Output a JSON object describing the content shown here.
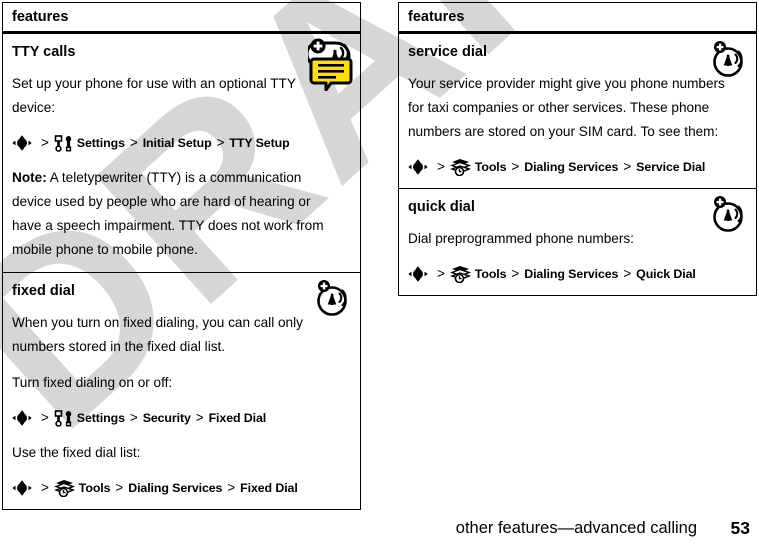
{
  "document": {
    "watermark": "DRAFT",
    "footer": {
      "title": "other features—advanced calling",
      "page_number": "53"
    }
  },
  "colors": {
    "text": "#000000",
    "rule": "#000000",
    "watermark": "#d6d6d6",
    "tty_icon_fill": "#ffe000"
  },
  "columns": [
    {
      "header": "features",
      "sections": [
        {
          "title": "TTY calls",
          "icon": "tty-icon",
          "blocks": [
            {
              "type": "para",
              "text": "Set up your phone for use with an optional TTY device:"
            },
            {
              "type": "path",
              "items": [
                {
                  "kind": "icon",
                  "name": "nav-key-icon"
                },
                {
                  "kind": "sep",
                  "text": ">"
                },
                {
                  "kind": "icon",
                  "name": "settings-icon"
                },
                {
                  "kind": "label",
                  "text": "Settings"
                },
                {
                  "kind": "sep",
                  "text": ">"
                },
                {
                  "kind": "label",
                  "text": "Initial Setup"
                },
                {
                  "kind": "sep",
                  "text": ">"
                },
                {
                  "kind": "label",
                  "text": "TTY Setup"
                }
              ]
            },
            {
              "type": "note",
              "bold": "Note:",
              "text": " A teletypewriter (TTY) is a communication device used by people who are hard of hearing or have a speech impairment. TTY does not work from mobile phone to mobile phone."
            }
          ]
        },
        {
          "title": "fixed dial",
          "icon": "network-service-icon",
          "blocks": [
            {
              "type": "para",
              "text": "When you turn on fixed dialing, you can call only numbers stored in the fixed dial list."
            },
            {
              "type": "para",
              "text": "Turn fixed dialing on or off:"
            },
            {
              "type": "path",
              "items": [
                {
                  "kind": "icon",
                  "name": "nav-key-icon"
                },
                {
                  "kind": "sep",
                  "text": ">"
                },
                {
                  "kind": "icon",
                  "name": "settings-icon"
                },
                {
                  "kind": "label",
                  "text": "Settings"
                },
                {
                  "kind": "sep",
                  "text": ">"
                },
                {
                  "kind": "label",
                  "text": "Security"
                },
                {
                  "kind": "sep",
                  "text": ">"
                },
                {
                  "kind": "label",
                  "text": "Fixed Dial"
                }
              ]
            },
            {
              "type": "para",
              "text": "Use the fixed dial list:"
            },
            {
              "type": "path",
              "items": [
                {
                  "kind": "icon",
                  "name": "nav-key-icon"
                },
                {
                  "kind": "sep",
                  "text": ">"
                },
                {
                  "kind": "icon",
                  "name": "tools-icon"
                },
                {
                  "kind": "label",
                  "text": "Tools"
                },
                {
                  "kind": "sep",
                  "text": ">"
                },
                {
                  "kind": "label",
                  "text": "Dialing Services"
                },
                {
                  "kind": "sep",
                  "text": ">"
                },
                {
                  "kind": "label",
                  "text": "Fixed Dial"
                }
              ]
            }
          ]
        }
      ]
    },
    {
      "header": "features",
      "sections": [
        {
          "title": "service dial",
          "icon": "network-service-icon",
          "blocks": [
            {
              "type": "para",
              "text": "Your service provider might give you phone numbers for taxi companies or other services. These phone numbers are stored on your SIM card. To see them:"
            },
            {
              "type": "path",
              "items": [
                {
                  "kind": "icon",
                  "name": "nav-key-icon"
                },
                {
                  "kind": "sep",
                  "text": ">"
                },
                {
                  "kind": "icon",
                  "name": "tools-icon"
                },
                {
                  "kind": "label",
                  "text": "Tools"
                },
                {
                  "kind": "sep",
                  "text": ">"
                },
                {
                  "kind": "label",
                  "text": "Dialing Services"
                },
                {
                  "kind": "sep",
                  "text": ">"
                },
                {
                  "kind": "label",
                  "text": "Service Dial"
                }
              ]
            }
          ]
        },
        {
          "title": "quick dial",
          "icon": "network-service-icon",
          "blocks": [
            {
              "type": "para",
              "text": "Dial preprogrammed phone numbers:"
            },
            {
              "type": "path",
              "items": [
                {
                  "kind": "icon",
                  "name": "nav-key-icon"
                },
                {
                  "kind": "sep",
                  "text": ">"
                },
                {
                  "kind": "icon",
                  "name": "tools-icon"
                },
                {
                  "kind": "label",
                  "text": "Tools"
                },
                {
                  "kind": "sep",
                  "text": ">"
                },
                {
                  "kind": "label",
                  "text": "Dialing Services"
                },
                {
                  "kind": "sep",
                  "text": ">"
                },
                {
                  "kind": "label",
                  "text": "Quick Dial"
                }
              ]
            }
          ]
        }
      ]
    }
  ]
}
